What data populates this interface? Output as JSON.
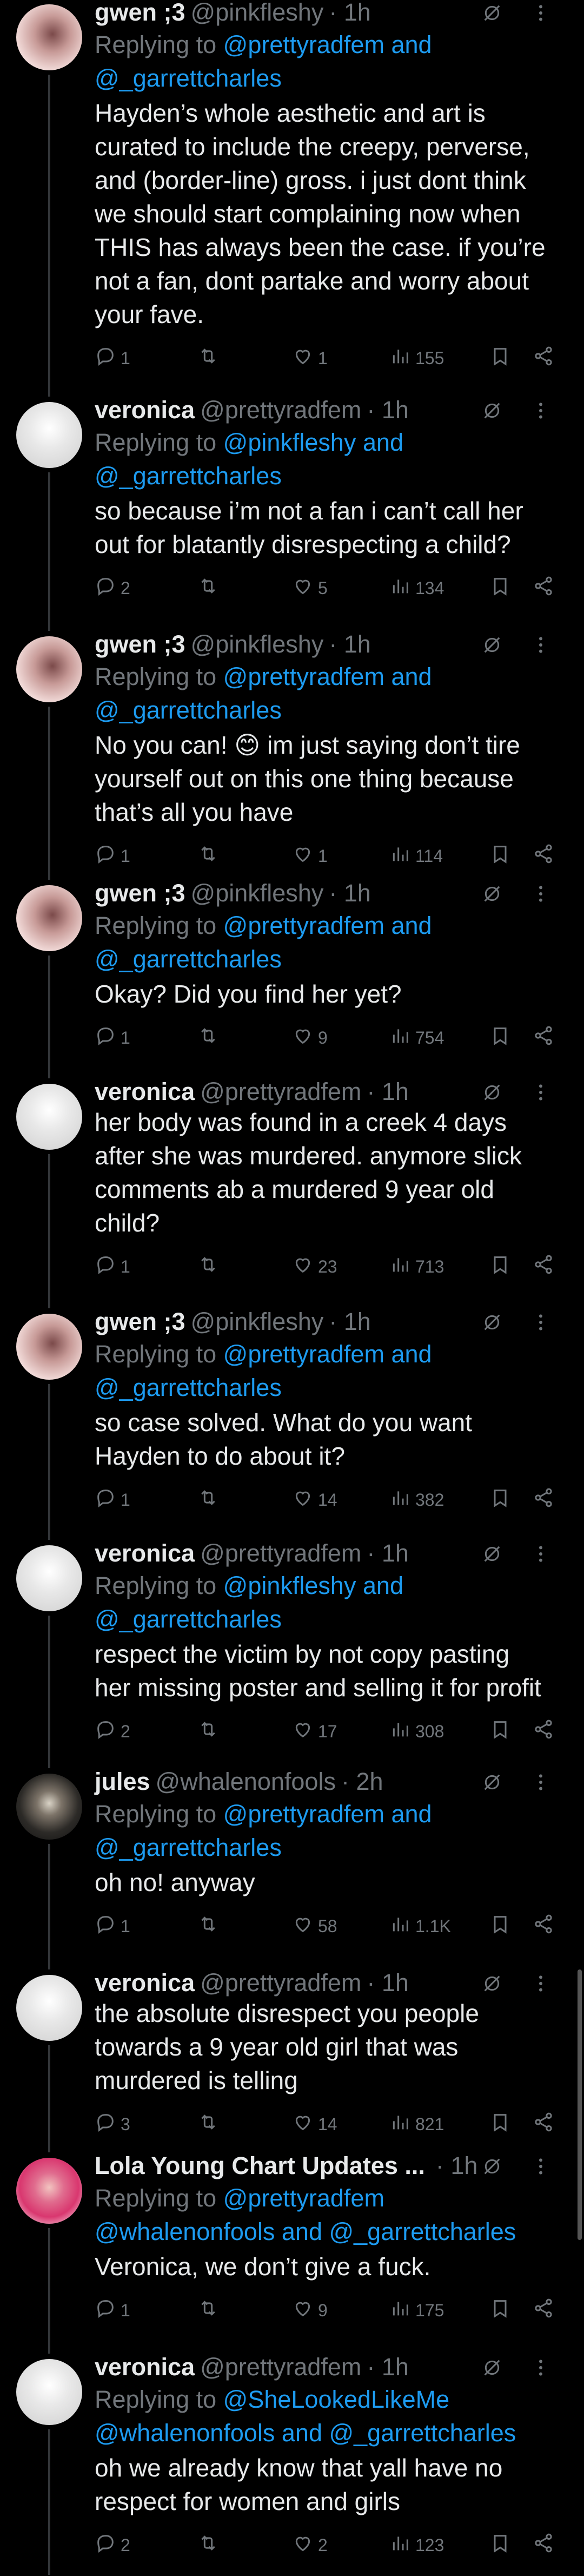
{
  "replying_prefix": "Replying to",
  "tweets": [
    {
      "name": "gwen ;3",
      "handle": "@pinkfleshy",
      "time": "· 1h",
      "avatar": "pink",
      "replying_line1": "@prettyradfem and",
      "replying_line2": "@_garrettcharles",
      "lines": [
        "Hayden’s whole aesthetic and art is",
        "curated to include the creepy, perverse,",
        "and (border-line) gross. i just dont think",
        "we should start complaining now when",
        "THIS has always been the case. if you’re",
        "not a fan, dont partake and worry about",
        "your fave."
      ],
      "replies": "1",
      "retweets": "",
      "likes": "1",
      "views": "155"
    },
    {
      "name": "veronica",
      "handle": "@prettyradfem",
      "time": "· 1h",
      "avatar": "grey",
      "replying_line1": "@pinkfleshy and",
      "replying_line2": "@_garrettcharles",
      "lines": [
        "so because i’m not a fan i can’t call her",
        "out for blatantly disrespecting a child?"
      ],
      "replies": "2",
      "retweets": "",
      "likes": "5",
      "views": "134"
    },
    {
      "name": "gwen ;3",
      "handle": "@pinkfleshy",
      "time": "· 1h",
      "avatar": "pink",
      "replying_line1": "@prettyradfem and",
      "replying_line2": "@_garrettcharles",
      "lines": [
        "No you can! 😊 im just saying don’t tire",
        "yourself out on this one thing because",
        "that’s all you have"
      ],
      "replies": "1",
      "retweets": "",
      "likes": "1",
      "views": "114"
    },
    {
      "name": "gwen ;3",
      "handle": "@pinkfleshy",
      "time": "· 1h",
      "avatar": "pink",
      "replying_line1": "@prettyradfem and",
      "replying_line2": "@_garrettcharles",
      "lines": [
        "Okay? Did you find her yet?"
      ],
      "replies": "1",
      "retweets": "",
      "likes": "9",
      "views": "754"
    },
    {
      "name": "veronica",
      "handle": "@prettyradfem",
      "time": "· 1h",
      "avatar": "grey",
      "replying_line1": "",
      "replying_line2": "",
      "lines": [
        "her body was found in a creek 4 days",
        "after she was murdered. anymore slick",
        "comments ab a murdered 9 year old",
        "child?"
      ],
      "replies": "1",
      "retweets": "",
      "likes": "23",
      "views": "713"
    },
    {
      "name": "gwen ;3",
      "handle": "@pinkfleshy",
      "time": "· 1h",
      "avatar": "pink",
      "replying_line1": "@prettyradfem and",
      "replying_line2": "@_garrettcharles",
      "lines": [
        "so case solved. What do you want",
        "Hayden to do about it?"
      ],
      "replies": "1",
      "retweets": "",
      "likes": "14",
      "views": "382"
    },
    {
      "name": "veronica",
      "handle": "@prettyradfem",
      "time": "· 1h",
      "avatar": "grey",
      "replying_line1": "@pinkfleshy and",
      "replying_line2": "@_garrettcharles",
      "lines": [
        "respect the victim by not copy pasting",
        "her missing poster and selling it for profit"
      ],
      "replies": "2",
      "retweets": "",
      "likes": "17",
      "views": "308"
    },
    {
      "name": "jules",
      "handle": "@whalenonfools",
      "time": "· 2h",
      "avatar": "dark",
      "replying_line1": "@prettyradfem and",
      "replying_line2": "@_garrettcharles",
      "lines": [
        "oh no! anyway"
      ],
      "replies": "1",
      "retweets": "",
      "likes": "58",
      "views": "1.1K"
    },
    {
      "name": "veronica",
      "handle": "@prettyradfem",
      "time": "· 1h",
      "avatar": "grey",
      "replying_line1": "",
      "replying_line2": "",
      "lines": [
        "the absolute disrespect you people",
        "towards a 9 year old girl that was",
        "murdered is telling"
      ],
      "replies": "3",
      "retweets": "",
      "likes": "14",
      "views": "821"
    },
    {
      "name": "Lola Young Chart Updates ...",
      "handle": "",
      "time": "· 1h",
      "avatar": "lola",
      "replying_line1": "@prettyradfem",
      "replying_line2": "@whalenonfools and @_garrettcharles",
      "lines": [
        "Veronica, we don’t give a fuck."
      ],
      "replies": "1",
      "retweets": "",
      "likes": "9",
      "views": "175"
    },
    {
      "name": "veronica",
      "handle": "@prettyradfem",
      "time": "· 1h",
      "avatar": "grey",
      "replying_line1": "@SheLookedLikeMe",
      "replying_line2": "@whalenonfools and @_garrettcharles",
      "lines": [
        "oh we already know that yall have no",
        "respect for women and girls"
      ],
      "replies": "2",
      "retweets": "",
      "likes": "2",
      "views": "123"
    }
  ]
}
